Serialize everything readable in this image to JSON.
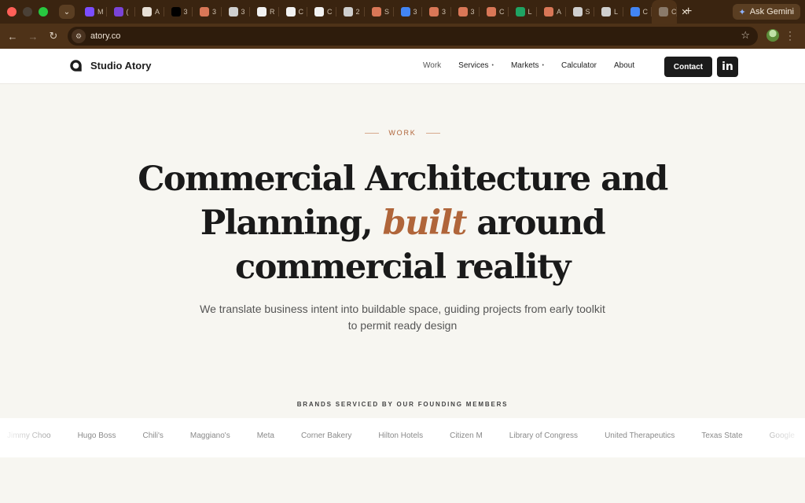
{
  "browser": {
    "tabs": [
      {
        "icon": "m-logo-icon",
        "title": "M",
        "color": "#7b4dff"
      },
      {
        "icon": "shield-icon",
        "title": "(",
        "color": "#7a44d8"
      },
      {
        "icon": "gear-icon",
        "title": "A",
        "color": "#e8e0d6"
      },
      {
        "icon": "triangle-icon",
        "title": "3",
        "color": "#000000"
      },
      {
        "icon": "claude-icon",
        "title": "3",
        "color": "#d97757"
      },
      {
        "icon": "globe-icon",
        "title": "3",
        "color": "#cfcfcf"
      },
      {
        "icon": "ring-icon",
        "title": "R",
        "color": "#f2f2f2"
      },
      {
        "icon": "github-icon",
        "title": "C",
        "color": "#f2f2f2"
      },
      {
        "icon": "chatgpt-icon",
        "title": "C",
        "color": "#f2f2f2"
      },
      {
        "icon": "globe-icon",
        "title": "2",
        "color": "#cfcfcf"
      },
      {
        "icon": "claude-icon",
        "title": "S",
        "color": "#d97757"
      },
      {
        "icon": "google-icon",
        "title": "3",
        "color": "#4285f4"
      },
      {
        "icon": "claude-icon",
        "title": "3",
        "color": "#d97757"
      },
      {
        "icon": "claude-icon",
        "title": "3",
        "color": "#d97757"
      },
      {
        "icon": "claude-icon",
        "title": "C",
        "color": "#d97757"
      },
      {
        "icon": "sheets-icon",
        "title": "L",
        "color": "#1fa463"
      },
      {
        "icon": "claude-icon",
        "title": "A",
        "color": "#d97757"
      },
      {
        "icon": "globe-icon",
        "title": "S",
        "color": "#cfcfcf"
      },
      {
        "icon": "globe-icon",
        "title": "L",
        "color": "#cfcfcf"
      },
      {
        "icon": "docs-icon",
        "title": "C",
        "color": "#4285f4"
      }
    ],
    "active_tab_title": "C",
    "new_tab": "+",
    "ask_gemini": "Ask Gemini",
    "url": "atory.co"
  },
  "site": {
    "brand": "Studio Atory",
    "nav": [
      {
        "label": "Work",
        "has_menu": false
      },
      {
        "label": "Services",
        "has_menu": true
      },
      {
        "label": "Markets",
        "has_menu": true
      },
      {
        "label": "Calculator",
        "has_menu": false
      },
      {
        "label": "About",
        "has_menu": false
      }
    ],
    "contact_label": "Contact",
    "linkedin_label": "in"
  },
  "hero": {
    "eyebrow": "WORK",
    "headline_part1": "Commercial Architecture and Planning, ",
    "headline_emphasis": "built",
    "headline_part2": " around commercial reality",
    "subtitle": "We translate business intent into buildable space, guiding projects from early toolkit to permit ready design"
  },
  "brands": {
    "label": "BRANDS SERVICED BY OUR FOUNDING MEMBERS",
    "items": [
      "Jimmy Choo",
      "Hugo Boss",
      "Chili's",
      "Maggiano's",
      "Meta",
      "Corner Bakery",
      "Hilton Hotels",
      "Citizen M",
      "Library of Congress",
      "United Therapeutics",
      "Texas State",
      "Google"
    ]
  }
}
